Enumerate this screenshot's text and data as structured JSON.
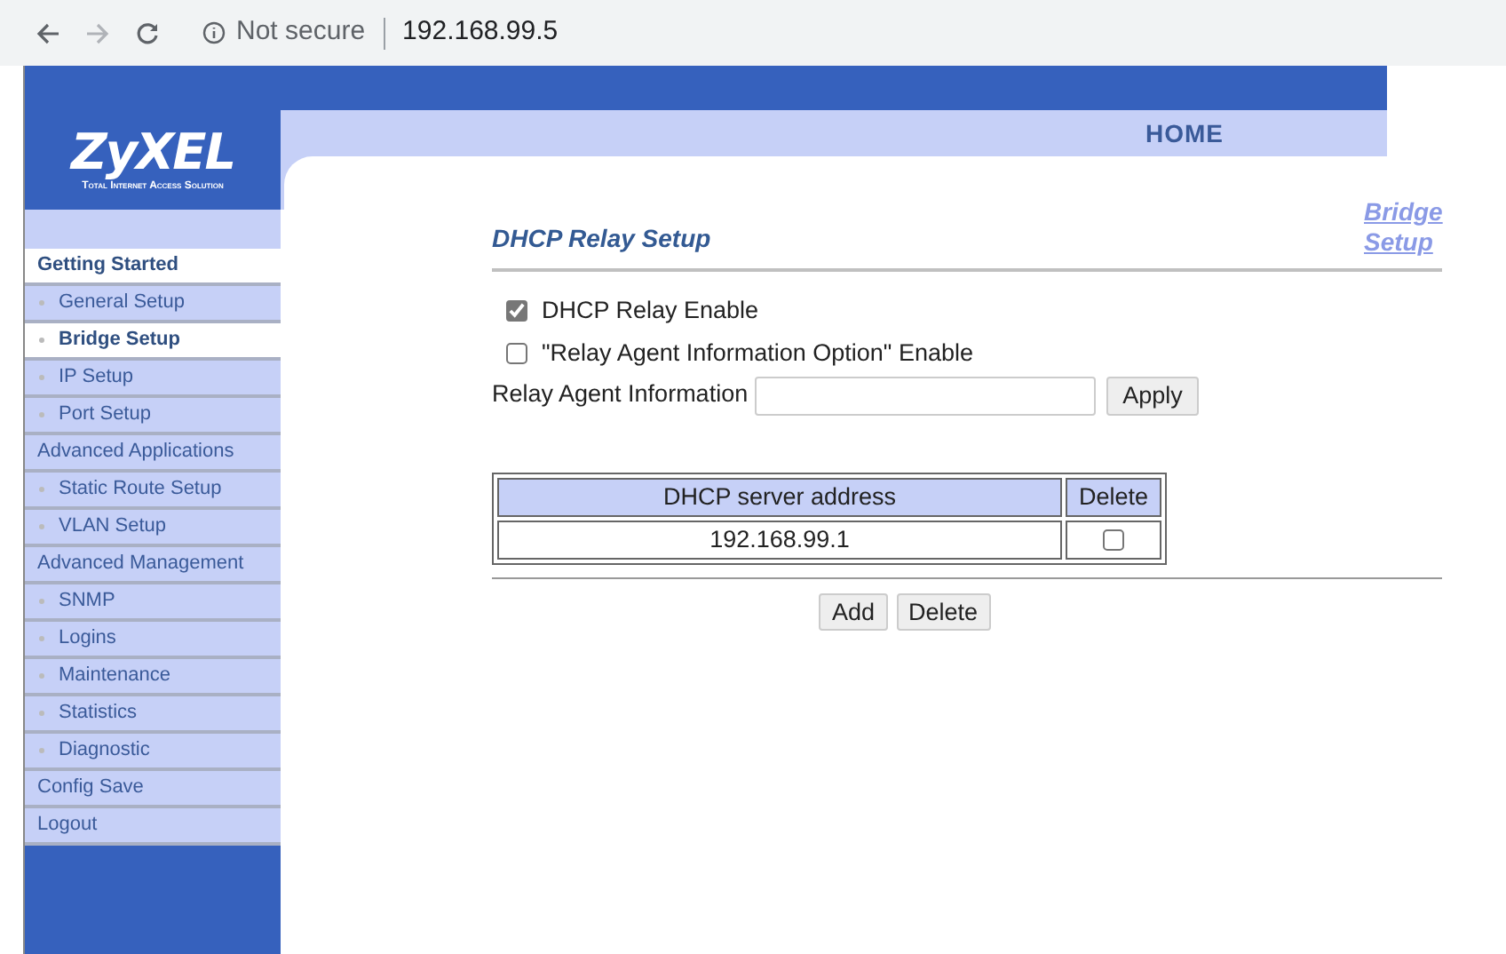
{
  "browser": {
    "security": "Not secure",
    "url": "192.168.99.5"
  },
  "logo": {
    "brand": "ZyXEL",
    "tagline": "Total Internet Access Solution"
  },
  "header": {
    "home_link": "HOME"
  },
  "sidebar": {
    "items": [
      {
        "label": "Getting Started",
        "kind": "section",
        "selected": true
      },
      {
        "label": "General Setup",
        "kind": "sub",
        "selected": false
      },
      {
        "label": "Bridge Setup",
        "kind": "sub",
        "selected": true
      },
      {
        "label": "IP Setup",
        "kind": "sub",
        "selected": false
      },
      {
        "label": "Port Setup",
        "kind": "sub",
        "selected": false
      },
      {
        "label": "Advanced Applications",
        "kind": "section",
        "selected": false
      },
      {
        "label": "Static Route Setup",
        "kind": "sub",
        "selected": false
      },
      {
        "label": "VLAN Setup",
        "kind": "sub",
        "selected": false
      },
      {
        "label": "Advanced Management",
        "kind": "section",
        "selected": false
      },
      {
        "label": "SNMP",
        "kind": "sub",
        "selected": false
      },
      {
        "label": "Logins",
        "kind": "sub",
        "selected": false
      },
      {
        "label": "Maintenance",
        "kind": "sub",
        "selected": false
      },
      {
        "label": "Statistics",
        "kind": "sub",
        "selected": false
      },
      {
        "label": "Diagnostic",
        "kind": "sub",
        "selected": false
      },
      {
        "label": "Config Save",
        "kind": "section",
        "selected": false
      },
      {
        "label": "Logout",
        "kind": "section",
        "selected": false
      }
    ]
  },
  "main": {
    "title": "DHCP Relay Setup",
    "breadcrumb_link": "Bridge Setup",
    "options": [
      {
        "label": "DHCP Relay Enable",
        "checked": true
      },
      {
        "label": "\"Relay Agent Information Option\" Enable",
        "checked": false
      }
    ],
    "relay_field": {
      "label": "Relay Agent Information",
      "button": "Apply"
    },
    "table": {
      "columns": [
        "DHCP server address",
        "Delete"
      ],
      "rows": [
        {
          "address": "192.168.99.1",
          "checked": false
        }
      ]
    },
    "buttons": [
      "Add",
      "Delete"
    ]
  }
}
